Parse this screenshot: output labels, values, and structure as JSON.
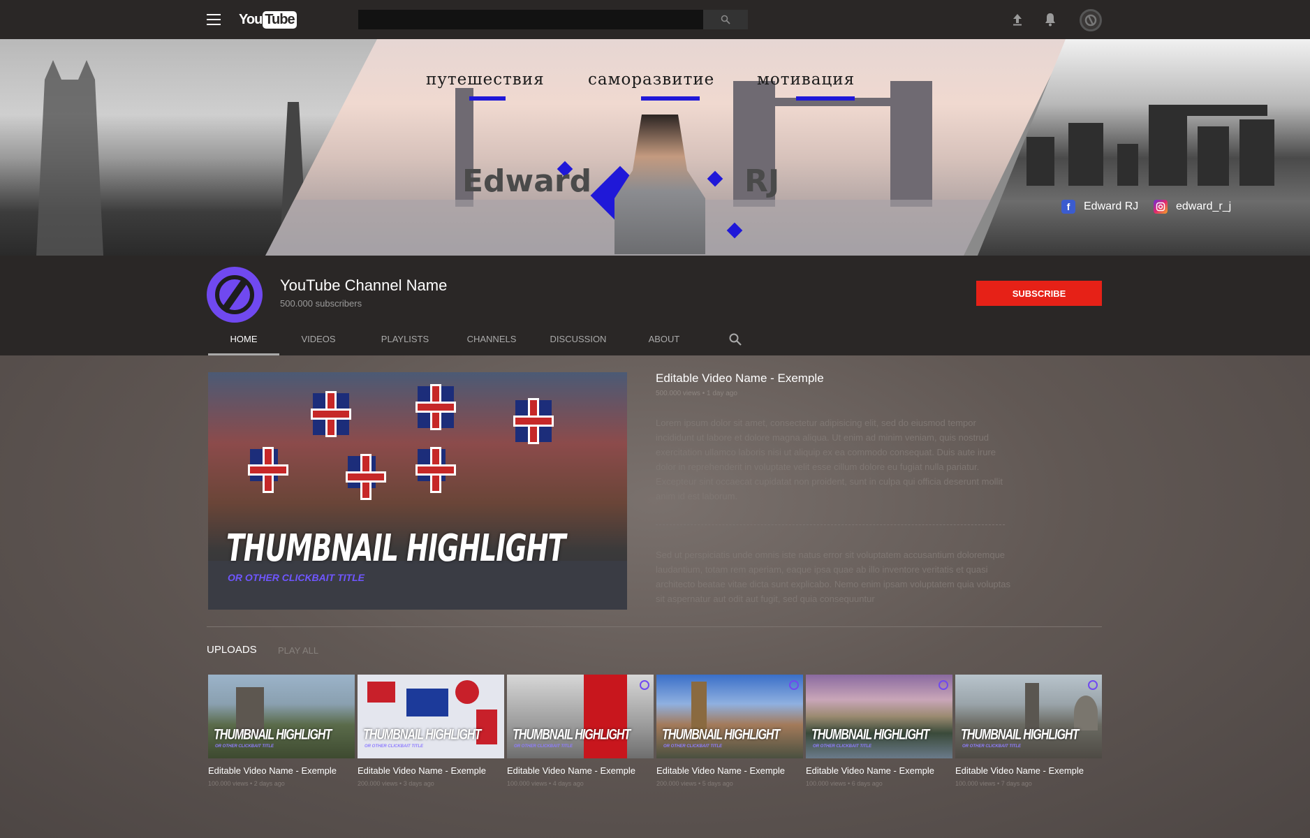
{
  "topbar": {
    "logo_you": "You",
    "logo_tube": "Tube",
    "search_placeholder": "",
    "icons": [
      "menu-icon",
      "search-icon",
      "upload-icon",
      "bell-icon",
      "account-icon"
    ]
  },
  "banner": {
    "word_1": "путешествия",
    "word_2": "саморазвитие",
    "word_3": "мотивация",
    "name_first": "Edward",
    "name_last": "RJ",
    "facebook_label": "Edward RJ",
    "instagram_label": "edward_r_j",
    "accent_color": "#1f18d8"
  },
  "channel": {
    "name": "YouTube Channel Name",
    "subscribers": "500.000 subscribers",
    "subscribe_label": "SUBSCRIBE",
    "tabs": [
      "HOME",
      "VIDEOS",
      "PLAYLISTS",
      "CHANNELS",
      "DISCUSSION",
      "ABOUT"
    ],
    "active_tab": "HOME"
  },
  "featured": {
    "thumbnail_title": "THUMBNAIL HIGHLIGHT",
    "thumbnail_subtitle": "OR OTHER CLICKBAIT TITLE",
    "title": "Editable Video Name - Exemple",
    "meta": "500.000 views • 1 day ago",
    "description_1": "Lorem ipsum dolor sit amet, consectetur adipisicing elit, sed do eiusmod tempor incididunt ut labore et dolore magna aliqua. Ut enim ad minim veniam, quis nostrud exercitation ullamco laboris nisi ut aliquip ex ea commodo consequat. Duis aute irure dolor in reprehenderit in voluptate velit esse cillum dolore eu fugiat nulla pariatur. Excepteur sint occaecat cupidatat non proident, sunt in culpa qui officia deserunt mollit anim id est laborum.",
    "description_2": "Sed ut perspiciatis unde omnis iste natus error sit voluptatem accusantium doloremque laudantium, totam rem aperiam, eaque ipsa quae ab illo inventore veritatis et quasi architecto beatae vitae dicta sunt explicabo. Nemo enim ipsam voluptatem quia voluptas sit aspernatur aut odit aut fugit, sed quia consequuntur"
  },
  "uploads": {
    "heading": "UPLOADS",
    "play_all": "PLAY ALL",
    "items": [
      {
        "thumb_label": "THUMBNAIL HIGHLIGHT",
        "thumb_sub": "OR OTHER CLICKBAIT TITLE",
        "title": "Editable Video Name - Exemple",
        "meta": "100.000 views • 2 days ago",
        "bg": "#6b7a5c"
      },
      {
        "thumb_label": "THUMBNAIL HIGHLIGHT",
        "thumb_sub": "OR OTHER CLICKBAIT TITLE",
        "title": "Editable Video Name - Exemple",
        "meta": "200.000 views • 3 days ago",
        "bg": "#c9cfe0"
      },
      {
        "thumb_label": "THUMBNAIL HIGHLIGHT",
        "thumb_sub": "OR OTHER CLICKBAIT TITLE",
        "title": "Editable Video Name - Exemple",
        "meta": "100.000 views • 4 days ago",
        "bg": "#a8a8a8"
      },
      {
        "thumb_label": "THUMBNAIL HIGHLIGHT",
        "thumb_sub": "OR OTHER CLICKBAIT TITLE",
        "title": "Editable Video Name - Exemple",
        "meta": "200.000 views • 5 days ago",
        "bg": "#4a6aa0"
      },
      {
        "thumb_label": "THUMBNAIL HIGHLIGHT",
        "thumb_sub": "OR OTHER CLICKBAIT TITLE",
        "title": "Editable Video Name - Exemple",
        "meta": "100.000 views • 6 days ago",
        "bg": "#7b6a7a"
      },
      {
        "thumb_label": "THUMBNAIL HIGHLIGHT",
        "thumb_sub": "OR OTHER CLICKBAIT TITLE",
        "title": "Editable Video Name - Exemple",
        "meta": "100.000 views • 7 days ago",
        "bg": "#8a8f96"
      }
    ]
  }
}
